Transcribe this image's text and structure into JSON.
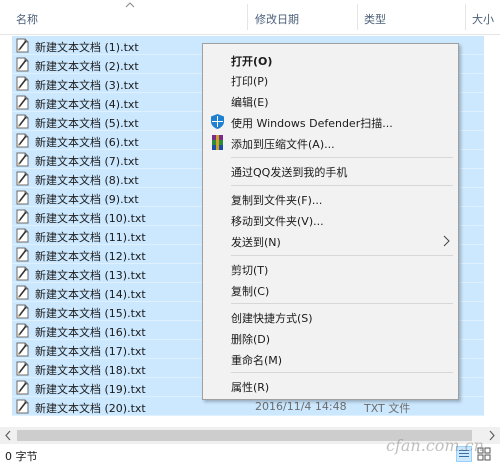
{
  "header": {
    "columns": {
      "name": "名称",
      "date": "修改日期",
      "type": "类型",
      "size": "大小"
    }
  },
  "files": [
    {
      "name": "新建文本文档 (1).txt"
    },
    {
      "name": "新建文本文档 (2).txt"
    },
    {
      "name": "新建文本文档 (3).txt"
    },
    {
      "name": "新建文本文档 (4).txt"
    },
    {
      "name": "新建文本文档 (5).txt"
    },
    {
      "name": "新建文本文档 (6).txt"
    },
    {
      "name": "新建文本文档 (7).txt"
    },
    {
      "name": "新建文本文档 (8).txt"
    },
    {
      "name": "新建文本文档 (9).txt"
    },
    {
      "name": "新建文本文档 (10).txt"
    },
    {
      "name": "新建文本文档 (11).txt"
    },
    {
      "name": "新建文本文档 (12).txt"
    },
    {
      "name": "新建文本文档 (13).txt"
    },
    {
      "name": "新建文本文档 (14).txt"
    },
    {
      "name": "新建文本文档 (15).txt"
    },
    {
      "name": "新建文本文档 (16).txt"
    },
    {
      "name": "新建文本文档 (17).txt"
    },
    {
      "name": "新建文本文档 (18).txt"
    },
    {
      "name": "新建文本文档 (19).txt"
    },
    {
      "name": "新建文本文档 (20).txt",
      "date": "2016/11/4 14:48",
      "type": "TXT 文件"
    }
  ],
  "context_menu": {
    "open": "打开(O)",
    "print": "打印(P)",
    "edit": "编辑(E)",
    "defender": "使用 Windows Defender扫描...",
    "add_archive": "添加到压缩文件(A)...",
    "send_qq": "通过QQ发送到我的手机",
    "copy_to": "复制到文件夹(F)...",
    "move_to": "移动到文件夹(V)...",
    "send_to": "发送到(N)",
    "cut": "剪切(T)",
    "copy": "复制(C)",
    "shortcut": "创建快捷方式(S)",
    "delete": "删除(D)",
    "rename": "重命名(M)",
    "properties": "属性(R)"
  },
  "status": {
    "text": "0 字节"
  },
  "watermark": "cfan.com.cn",
  "colors": {
    "selection": "#cce8ff",
    "menu_bg": "#f2f2f2",
    "header_text": "#4c607a"
  }
}
